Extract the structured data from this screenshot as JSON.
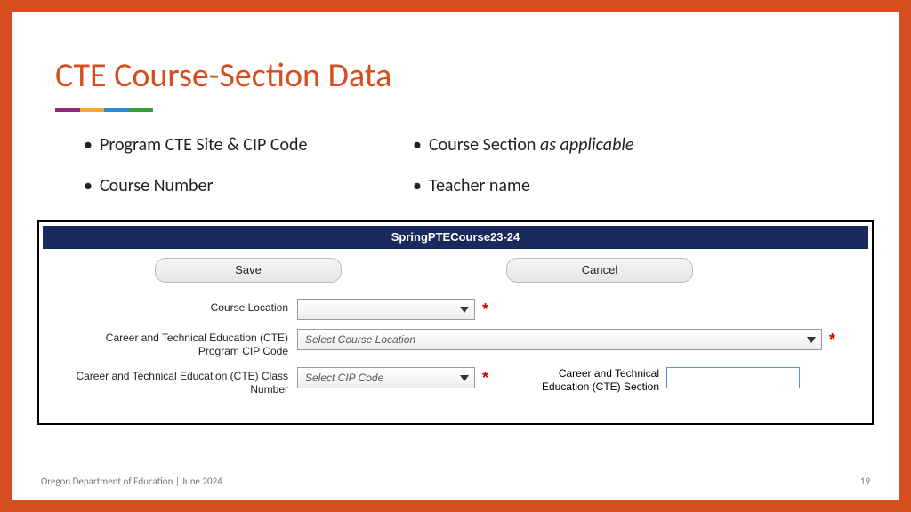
{
  "slide": {
    "title": "CTE Course-Section Data",
    "bullets_left": [
      {
        "text": "Program CTE Site & CIP Code"
      },
      {
        "text": "Course Number"
      }
    ],
    "bullets_right": [
      {
        "prefix": "Course Section ",
        "italic": "as applicable"
      },
      {
        "prefix": "Teacher name",
        "italic": ""
      }
    ],
    "footer_left": "Oregon Department of Education | June 2024",
    "footer_right": "19"
  },
  "form": {
    "header": "SpringPTECourse23-24",
    "save_label": "Save",
    "cancel_label": "Cancel",
    "required_mark": "*",
    "fields": {
      "course_location": {
        "label": "Course Location",
        "placeholder": ""
      },
      "cip_code": {
        "label": "Career and Technical Education (CTE) Program CIP Code",
        "placeholder": "Select Course Location"
      },
      "class_number": {
        "label": "Career and Technical Education (CTE) Class Number",
        "placeholder": "Select CIP Code"
      },
      "section": {
        "label": "Career and Technical Education (CTE) Section"
      }
    }
  }
}
